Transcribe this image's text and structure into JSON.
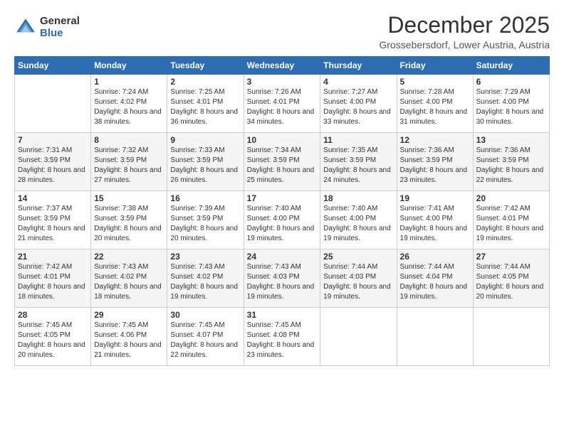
{
  "logo": {
    "general": "General",
    "blue": "Blue"
  },
  "header": {
    "title": "December 2025",
    "location": "Grossebersdorf, Lower Austria, Austria"
  },
  "days_header": [
    "Sunday",
    "Monday",
    "Tuesday",
    "Wednesday",
    "Thursday",
    "Friday",
    "Saturday"
  ],
  "weeks": [
    [
      {
        "day": "",
        "sunrise": "",
        "sunset": "",
        "daylight": ""
      },
      {
        "day": "1",
        "sunrise": "Sunrise: 7:24 AM",
        "sunset": "Sunset: 4:02 PM",
        "daylight": "Daylight: 8 hours and 38 minutes."
      },
      {
        "day": "2",
        "sunrise": "Sunrise: 7:25 AM",
        "sunset": "Sunset: 4:01 PM",
        "daylight": "Daylight: 8 hours and 36 minutes."
      },
      {
        "day": "3",
        "sunrise": "Sunrise: 7:26 AM",
        "sunset": "Sunset: 4:01 PM",
        "daylight": "Daylight: 8 hours and 34 minutes."
      },
      {
        "day": "4",
        "sunrise": "Sunrise: 7:27 AM",
        "sunset": "Sunset: 4:00 PM",
        "daylight": "Daylight: 8 hours and 33 minutes."
      },
      {
        "day": "5",
        "sunrise": "Sunrise: 7:28 AM",
        "sunset": "Sunset: 4:00 PM",
        "daylight": "Daylight: 8 hours and 31 minutes."
      },
      {
        "day": "6",
        "sunrise": "Sunrise: 7:29 AM",
        "sunset": "Sunset: 4:00 PM",
        "daylight": "Daylight: 8 hours and 30 minutes."
      }
    ],
    [
      {
        "day": "7",
        "sunrise": "Sunrise: 7:31 AM",
        "sunset": "Sunset: 3:59 PM",
        "daylight": "Daylight: 8 hours and 28 minutes."
      },
      {
        "day": "8",
        "sunrise": "Sunrise: 7:32 AM",
        "sunset": "Sunset: 3:59 PM",
        "daylight": "Daylight: 8 hours and 27 minutes."
      },
      {
        "day": "9",
        "sunrise": "Sunrise: 7:33 AM",
        "sunset": "Sunset: 3:59 PM",
        "daylight": "Daylight: 8 hours and 26 minutes."
      },
      {
        "day": "10",
        "sunrise": "Sunrise: 7:34 AM",
        "sunset": "Sunset: 3:59 PM",
        "daylight": "Daylight: 8 hours and 25 minutes."
      },
      {
        "day": "11",
        "sunrise": "Sunrise: 7:35 AM",
        "sunset": "Sunset: 3:59 PM",
        "daylight": "Daylight: 8 hours and 24 minutes."
      },
      {
        "day": "12",
        "sunrise": "Sunrise: 7:36 AM",
        "sunset": "Sunset: 3:59 PM",
        "daylight": "Daylight: 8 hours and 23 minutes."
      },
      {
        "day": "13",
        "sunrise": "Sunrise: 7:36 AM",
        "sunset": "Sunset: 3:59 PM",
        "daylight": "Daylight: 8 hours and 22 minutes."
      }
    ],
    [
      {
        "day": "14",
        "sunrise": "Sunrise: 7:37 AM",
        "sunset": "Sunset: 3:59 PM",
        "daylight": "Daylight: 8 hours and 21 minutes."
      },
      {
        "day": "15",
        "sunrise": "Sunrise: 7:38 AM",
        "sunset": "Sunset: 3:59 PM",
        "daylight": "Daylight: 8 hours and 20 minutes."
      },
      {
        "day": "16",
        "sunrise": "Sunrise: 7:39 AM",
        "sunset": "Sunset: 3:59 PM",
        "daylight": "Daylight: 8 hours and 20 minutes."
      },
      {
        "day": "17",
        "sunrise": "Sunrise: 7:40 AM",
        "sunset": "Sunset: 4:00 PM",
        "daylight": "Daylight: 8 hours and 19 minutes."
      },
      {
        "day": "18",
        "sunrise": "Sunrise: 7:40 AM",
        "sunset": "Sunset: 4:00 PM",
        "daylight": "Daylight: 8 hours and 19 minutes."
      },
      {
        "day": "19",
        "sunrise": "Sunrise: 7:41 AM",
        "sunset": "Sunset: 4:00 PM",
        "daylight": "Daylight: 8 hours and 19 minutes."
      },
      {
        "day": "20",
        "sunrise": "Sunrise: 7:42 AM",
        "sunset": "Sunset: 4:01 PM",
        "daylight": "Daylight: 8 hours and 19 minutes."
      }
    ],
    [
      {
        "day": "21",
        "sunrise": "Sunrise: 7:42 AM",
        "sunset": "Sunset: 4:01 PM",
        "daylight": "Daylight: 8 hours and 18 minutes."
      },
      {
        "day": "22",
        "sunrise": "Sunrise: 7:43 AM",
        "sunset": "Sunset: 4:02 PM",
        "daylight": "Daylight: 8 hours and 18 minutes."
      },
      {
        "day": "23",
        "sunrise": "Sunrise: 7:43 AM",
        "sunset": "Sunset: 4:02 PM",
        "daylight": "Daylight: 8 hours and 19 minutes."
      },
      {
        "day": "24",
        "sunrise": "Sunrise: 7:43 AM",
        "sunset": "Sunset: 4:03 PM",
        "daylight": "Daylight: 8 hours and 19 minutes."
      },
      {
        "day": "25",
        "sunrise": "Sunrise: 7:44 AM",
        "sunset": "Sunset: 4:03 PM",
        "daylight": "Daylight: 8 hours and 19 minutes."
      },
      {
        "day": "26",
        "sunrise": "Sunrise: 7:44 AM",
        "sunset": "Sunset: 4:04 PM",
        "daylight": "Daylight: 8 hours and 19 minutes."
      },
      {
        "day": "27",
        "sunrise": "Sunrise: 7:44 AM",
        "sunset": "Sunset: 4:05 PM",
        "daylight": "Daylight: 8 hours and 20 minutes."
      }
    ],
    [
      {
        "day": "28",
        "sunrise": "Sunrise: 7:45 AM",
        "sunset": "Sunset: 4:05 PM",
        "daylight": "Daylight: 8 hours and 20 minutes."
      },
      {
        "day": "29",
        "sunrise": "Sunrise: 7:45 AM",
        "sunset": "Sunset: 4:06 PM",
        "daylight": "Daylight: 8 hours and 21 minutes."
      },
      {
        "day": "30",
        "sunrise": "Sunrise: 7:45 AM",
        "sunset": "Sunset: 4:07 PM",
        "daylight": "Daylight: 8 hours and 22 minutes."
      },
      {
        "day": "31",
        "sunrise": "Sunrise: 7:45 AM",
        "sunset": "Sunset: 4:08 PM",
        "daylight": "Daylight: 8 hours and 23 minutes."
      },
      {
        "day": "",
        "sunrise": "",
        "sunset": "",
        "daylight": ""
      },
      {
        "day": "",
        "sunrise": "",
        "sunset": "",
        "daylight": ""
      },
      {
        "day": "",
        "sunrise": "",
        "sunset": "",
        "daylight": ""
      }
    ]
  ]
}
